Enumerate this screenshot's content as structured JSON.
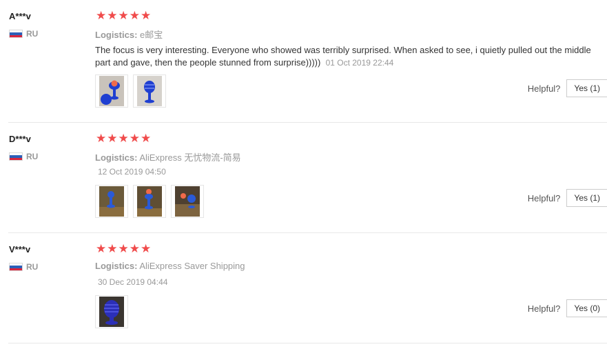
{
  "colors": {
    "star": "#f04b4b",
    "muted": "#999999",
    "divider": "#e8e8e8"
  },
  "reviews": [
    {
      "user": "A***v",
      "country": "RU",
      "stars": 5,
      "logistics_label": "Logistics:",
      "logistics_value": "e邮宝",
      "text": "The focus is very interesting. Everyone who showed was terribly surprised. When asked to see, i quietly pulled out the middle part and gave, then the people stunned from surprise)))))",
      "date": "01 Oct 2019 22:44",
      "images": [
        "product-photo-1",
        "product-photo-2"
      ],
      "helpful_label": "Helpful?",
      "yes_label": "Yes (1)"
    },
    {
      "user": "D***v",
      "country": "RU",
      "stars": 5,
      "logistics_label": "Logistics:",
      "logistics_value": "AliExpress 无忧物流-简易",
      "text": "",
      "date": "12 Oct 2019 04:50",
      "images": [
        "product-photo-1",
        "product-photo-2",
        "product-photo-3"
      ],
      "helpful_label": "Helpful?",
      "yes_label": "Yes (1)"
    },
    {
      "user": "V***v",
      "country": "RU",
      "stars": 5,
      "logistics_label": "Logistics:",
      "logistics_value": "AliExpress Saver Shipping",
      "text": "",
      "date": "30 Dec 2019 04:44",
      "images": [
        "product-photo-1"
      ],
      "helpful_label": "Helpful?",
      "yes_label": "Yes (0)"
    }
  ]
}
